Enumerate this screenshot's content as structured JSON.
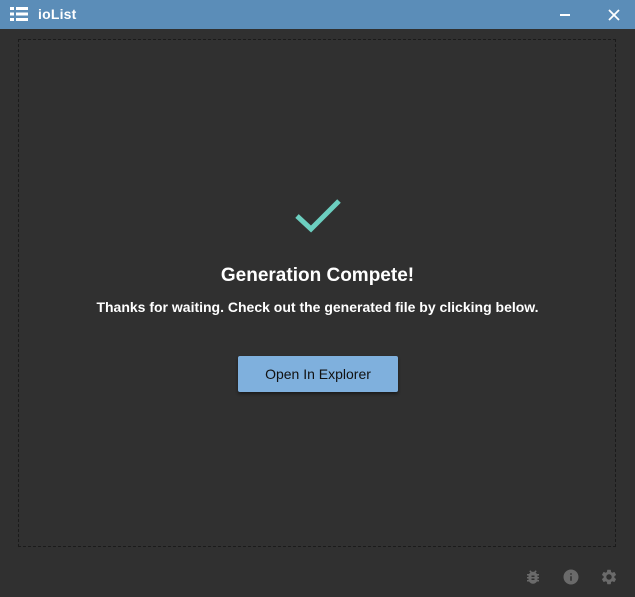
{
  "window": {
    "title": "ioList",
    "icons": {
      "app": "list-icon",
      "minimize": "minimize-icon",
      "close": "close-icon"
    }
  },
  "main": {
    "status_icon": "checkmark-icon",
    "heading": "Generation Compete!",
    "message": "Thanks for waiting. Check out the generated file by clicking below.",
    "open_button_label": "Open In Explorer"
  },
  "footer": {
    "icons": [
      "bug-icon",
      "info-icon",
      "settings-gear-icon"
    ]
  },
  "colors": {
    "titlebar": "#5b8db8",
    "background": "#303030",
    "check": "#6ccfc0",
    "button": "#7fb0dd",
    "footer_icon": "#6a6a6a"
  }
}
